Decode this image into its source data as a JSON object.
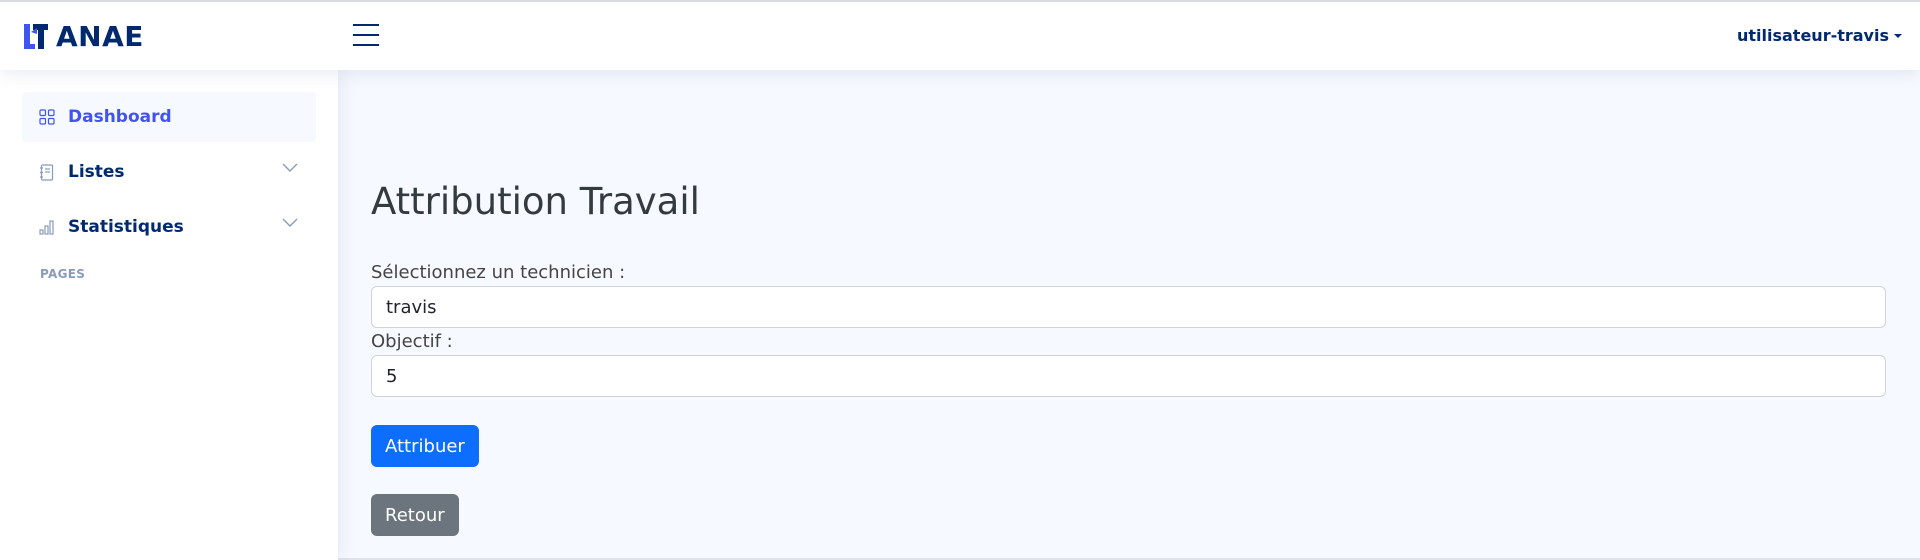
{
  "brand": {
    "name": "ANAE",
    "color": "#012970"
  },
  "header": {
    "user": "utilisateur-travis"
  },
  "sidebar": {
    "items": [
      {
        "label": "Dashboard",
        "icon": "grid-icon",
        "active": true
      },
      {
        "label": "Listes",
        "icon": "journal-icon",
        "active": false
      },
      {
        "label": "Statistiques",
        "icon": "bar-chart-icon",
        "active": false
      }
    ],
    "heading": "Pages"
  },
  "main": {
    "title": "Attribution Travail",
    "technician_label": "Sélectionnez un technicien :",
    "technician_value": "travis",
    "objective_label": "Objectif :",
    "objective_value": "5",
    "assign_button": "Attribuer",
    "back_button": "Retour"
  },
  "colors": {
    "accent": "#4154f1",
    "primary_button": "#0d6efd",
    "secondary_button": "#6c757d",
    "background": "#f6f9ff"
  }
}
